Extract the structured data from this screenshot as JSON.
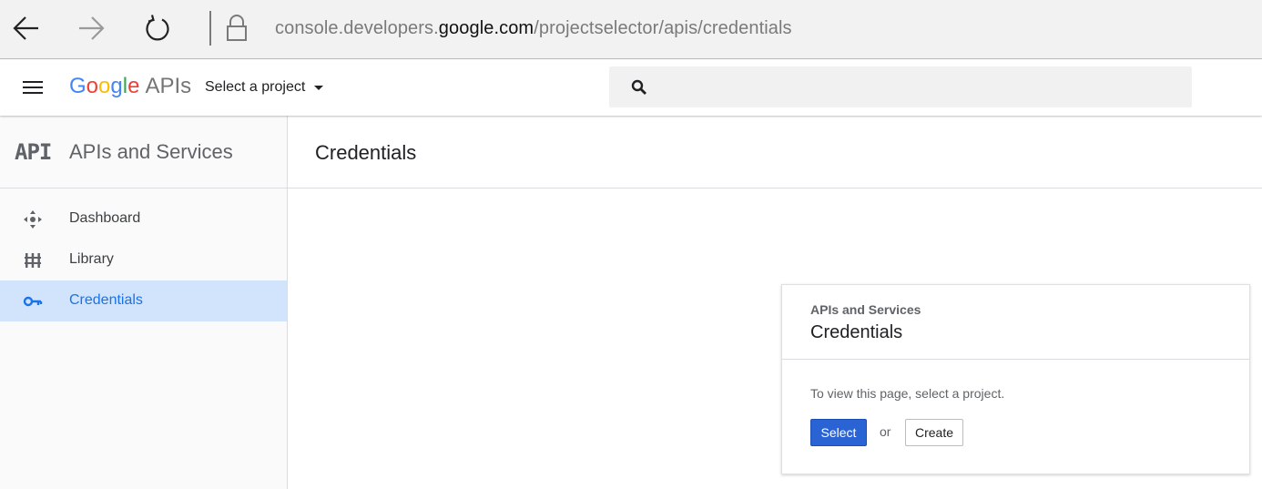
{
  "browser": {
    "url_prefix": "console.developers.",
    "url_domain": "google.com",
    "url_path": "/projectselector/apis/credentials"
  },
  "header": {
    "logo_letters": [
      "G",
      "o",
      "o",
      "g",
      "l",
      "e"
    ],
    "logo_colors": [
      "#4285F4",
      "#EA4335",
      "#FBBC05",
      "#4285F4",
      "#34A853",
      "#EA4335"
    ],
    "logo_suffix": "APIs",
    "project_select_label": "Select a project",
    "search_placeholder": ""
  },
  "sidebar": {
    "section_title": "APIs and Services",
    "logo_mark": "API",
    "items": [
      {
        "label": "Dashboard",
        "icon": "dashboard-icon",
        "active": false
      },
      {
        "label": "Library",
        "icon": "library-icon",
        "active": false
      },
      {
        "label": "Credentials",
        "icon": "key-icon",
        "active": true
      }
    ]
  },
  "main": {
    "title": "Credentials"
  },
  "card": {
    "subtitle": "APIs and Services",
    "title": "Credentials",
    "message": "To view this page, select a project.",
    "select_label": "Select",
    "or_label": "or",
    "create_label": "Create"
  },
  "colors": {
    "accent": "#1a73e8",
    "active_bg": "#d2e3fc",
    "primary_button": "#2a63d4"
  }
}
